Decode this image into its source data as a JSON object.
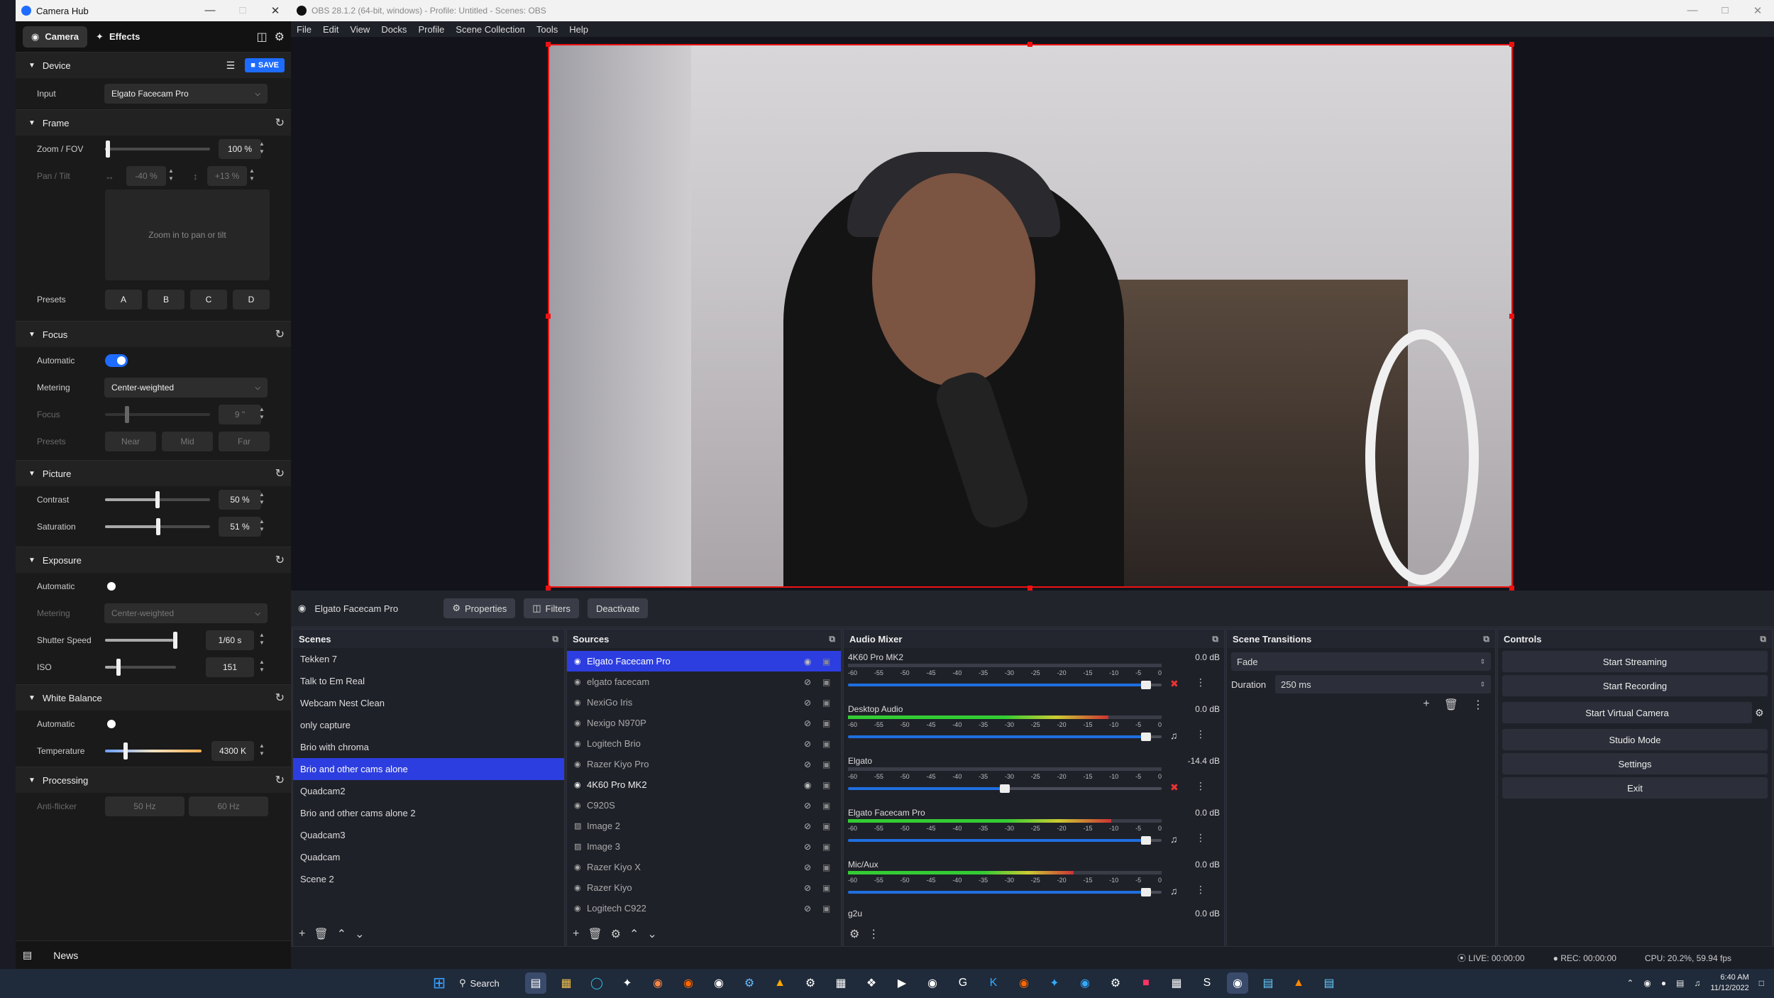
{
  "camerahub": {
    "title": "Camera Hub",
    "tabs": [
      "Camera",
      "Effects"
    ],
    "save_label": "SAVE",
    "device": {
      "header": "Device",
      "input_label": "Input",
      "input_value": "Elgato Facecam Pro"
    },
    "frame": {
      "header": "Frame",
      "zoom_label": "Zoom / FOV",
      "zoom_value": "100 %",
      "zoom_level": 0.03,
      "pan_label": "Pan / Tilt",
      "pan_value": "-40 %",
      "tilt_value": "+13 %",
      "zoom_hint": "Zoom in to pan or tilt",
      "presets_label": "Presets",
      "presets": [
        "A",
        "B",
        "C",
        "D"
      ]
    },
    "focus": {
      "header": "Focus",
      "auto_label": "Automatic",
      "metering_label": "Metering",
      "metering_value": "Center-weighted",
      "focus_label": "Focus",
      "focus_value": "9 \"",
      "presets_label": "Presets",
      "presets": [
        "Near",
        "Mid",
        "Far"
      ]
    },
    "picture": {
      "header": "Picture",
      "contrast_label": "Contrast",
      "contrast_value": "50 %",
      "contrast_level": 0.5,
      "saturation_label": "Saturation",
      "saturation_value": "51 %",
      "saturation_level": 0.51
    },
    "exposure": {
      "header": "Exposure",
      "auto_label": "Automatic",
      "metering_label": "Metering",
      "metering_value": "Center-weighted",
      "shutter_label": "Shutter Speed",
      "shutter_value": "1/60 s",
      "iso_label": "ISO",
      "iso_value": "151"
    },
    "whitebalance": {
      "header": "White Balance",
      "auto_label": "Automatic",
      "temp_label": "Temperature",
      "temp_value": "4300 K"
    },
    "processing": {
      "header": "Processing",
      "antiflicker_label": "Anti-flicker",
      "options": [
        "50 Hz",
        "60 Hz"
      ]
    },
    "news_label": "News"
  },
  "obs": {
    "title": "OBS 28.1.2 (64-bit, windows) - Profile: Untitled - Scenes: OBS",
    "menu": [
      "File",
      "Edit",
      "View",
      "Docks",
      "Profile",
      "Scene Collection",
      "Tools",
      "Help"
    ],
    "source_bar": {
      "name": "Elgato Facecam Pro",
      "properties": "Properties",
      "filters": "Filters",
      "deactivate": "Deactivate"
    },
    "scenes": {
      "title": "Scenes",
      "items": [
        "Tekken 7",
        "Talk to Em Real",
        "Webcam Nest Clean",
        "only capture",
        "Brio with chroma",
        "Brio and other cams alone",
        "Quadcam2",
        "Brio and other cams alone 2",
        "Quadcam3",
        "Quadcam",
        "Scene 2"
      ],
      "selected": 5
    },
    "sources": {
      "title": "Sources",
      "items": [
        "Elgato Facecam Pro",
        "elgato facecam",
        "NexiGo Iris",
        "Nexigo N970P",
        "Logitech Brio",
        "Razer Kiyo Pro",
        "4K60 Pro MK2",
        "C920S",
        "Image 2",
        "Image 3",
        "Razer Kiyo X",
        "Razer Kiyo",
        "Logitech C922"
      ]
    },
    "mixer": {
      "title": "Audio Mixer",
      "channels": [
        {
          "name": "4K60 Pro MK2",
          "db": "0.0 dB",
          "level": 0.0,
          "volume": 0.95,
          "muted": true
        },
        {
          "name": "Desktop Audio",
          "db": "0.0 dB",
          "level": 0.83,
          "volume": 0.95,
          "muted": false
        },
        {
          "name": "Elgato",
          "db": "-14.4 dB",
          "level": 0.0,
          "volume": 0.5,
          "muted": true
        },
        {
          "name": "Elgato Facecam Pro",
          "db": "0.0 dB",
          "level": 0.84,
          "volume": 0.95,
          "muted": false
        },
        {
          "name": "Mic/Aux",
          "db": "0.0 dB",
          "level": 0.72,
          "volume": 0.95,
          "muted": false
        }
      ],
      "partial_channel": {
        "name": "g2u",
        "db": "0.0 dB"
      },
      "ticks": [
        "-60",
        "-55",
        "-50",
        "-45",
        "-40",
        "-35",
        "-30",
        "-25",
        "-20",
        "-15",
        "-10",
        "-5",
        "0"
      ]
    },
    "transitions": {
      "title": "Scene Transitions",
      "transition": "Fade",
      "duration_label": "Duration",
      "duration_value": "250 ms"
    },
    "controls": {
      "title": "Controls",
      "buttons": [
        "Start Streaming",
        "Start Recording",
        "Start Virtual Camera",
        "Studio Mode",
        "Settings",
        "Exit"
      ]
    },
    "status": {
      "live": "LIVE: 00:00:00",
      "rec": "REC: 00:00:00",
      "cpu": "CPU: 20.2%, 59.94 fps"
    }
  },
  "taskbar": {
    "search_label": "Search",
    "time": "6:40 AM",
    "date": "11/12/2022"
  }
}
